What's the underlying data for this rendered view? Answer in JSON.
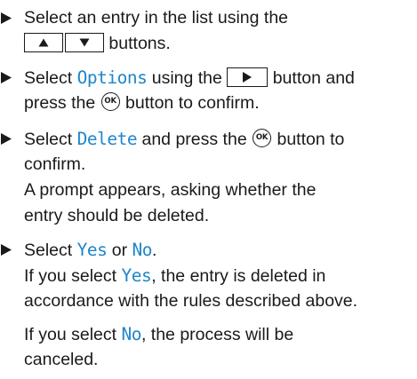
{
  "steps": [
    {
      "lines": [
        {
          "pre": "Select an entry in the list using the"
        },
        {
          "post": " buttons."
        }
      ]
    },
    {
      "lines": [
        {
          "pre": "Select ",
          "highlight": "Options",
          "mid": " using the ",
          "post": " button and"
        },
        {
          "pre": "press the ",
          "post": " button to confirm."
        }
      ]
    },
    {
      "lines": [
        {
          "pre": "Select ",
          "highlight": "Delete",
          "mid": " and press the ",
          "post": " button to"
        },
        {
          "pre": "confirm."
        },
        {
          "pre": "A prompt appears, asking whether the"
        },
        {
          "pre": "entry should be deleted."
        }
      ]
    },
    {
      "lines": [
        {
          "pre": "Select ",
          "highlight": "Yes",
          "mid": " or ",
          "highlight2": "No",
          "post": "."
        },
        {
          "pre": "If you select ",
          "highlight": "Yes",
          "post": ", the entry is deleted in"
        },
        {
          "pre": "accordance with the rules described above."
        },
        {
          "pre": "If you select ",
          "highlight": "No",
          "post": ", the process will be"
        },
        {
          "pre": "canceled."
        }
      ]
    }
  ],
  "buttons": {
    "up_icon": "up-triangle-icon",
    "down_icon": "down-triangle-icon",
    "right_icon": "right-triangle-icon",
    "ok_label": "OK"
  },
  "colors": {
    "text": "#1a1a1a",
    "highlight": "#1f86c9"
  }
}
